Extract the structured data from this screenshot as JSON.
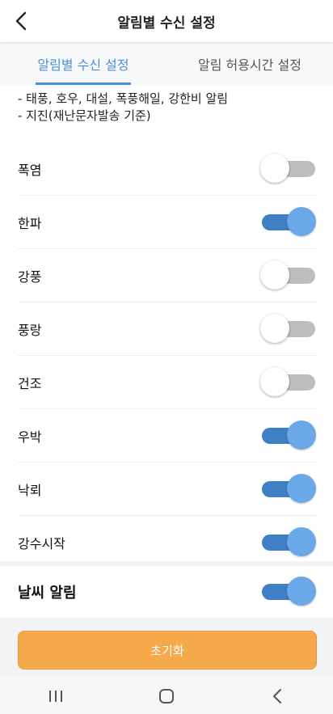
{
  "header": {
    "title": "알림별 수신 설정",
    "back_icon": "chevron-left-icon"
  },
  "tabs": [
    {
      "label": "알림별 수신 설정",
      "active": true
    },
    {
      "label": "알림 허용시간 설정",
      "active": false
    }
  ],
  "notes": [
    "- 태풍, 호우, 대설, 폭풍해일, 강한비 알림",
    "- 지진(재난문자발송 기준)"
  ],
  "alerts": [
    {
      "label": "폭염",
      "on": false
    },
    {
      "label": "한파",
      "on": true
    },
    {
      "label": "강풍",
      "on": false
    },
    {
      "label": "풍랑",
      "on": false
    },
    {
      "label": "건조",
      "on": false
    },
    {
      "label": "우박",
      "on": true
    },
    {
      "label": "낙뢰",
      "on": true
    },
    {
      "label": "강수시작",
      "on": true
    }
  ],
  "weather_alert": {
    "label": "날씨 알림",
    "on": true
  },
  "reset_button": {
    "label": "초기화"
  },
  "navbar": {
    "icons": [
      "recent-apps-icon",
      "home-icon",
      "back-icon"
    ]
  },
  "colors": {
    "accent": "#4a90d9",
    "toggle_on_track": "#3f7fc6",
    "toggle_on_knob": "#6aa8ea",
    "toggle_off_track": "#bdbdbd",
    "reset_button": "#f6a94a"
  }
}
